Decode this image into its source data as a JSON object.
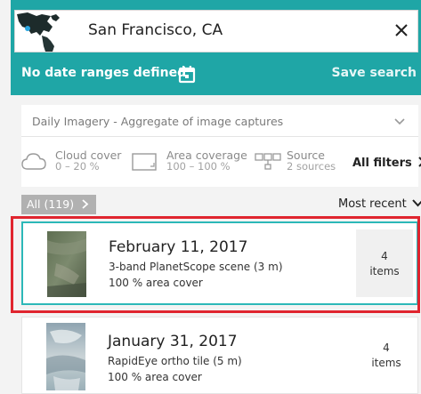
{
  "header": {
    "location": "San Francisco, CA",
    "date_status": "No date ranges defined",
    "save_search": "Save search"
  },
  "filters": {
    "imagery_type": "Daily Imagery - Aggregate of image captures",
    "cloud_cover": {
      "label": "Cloud cover",
      "value": "0 – 20 %"
    },
    "area_coverage": {
      "label": "Area coverage",
      "value": "100 – 100 %"
    },
    "source": {
      "label": "Source",
      "value": "2 sources"
    },
    "all_filters": "All filters"
  },
  "results_header": {
    "all_label": "All (119)",
    "sort": "Most recent"
  },
  "results": [
    {
      "date": "February 11, 2017",
      "description": "3-band PlanetScope scene (3 m)",
      "coverage": "100 % area cover",
      "items_count": "4",
      "items_label": "items"
    },
    {
      "date": "January 31, 2017",
      "description": "RapidEye ortho tile (5 m)",
      "coverage": "100 % area cover",
      "items_count": "4",
      "items_label": "items"
    }
  ],
  "colors": {
    "header_teal": "#1fa6a6",
    "selected_border": "#2cb8b8",
    "highlight_red": "#e0252f",
    "badge_gray": "#b1b1b1"
  },
  "icons": [
    "close-icon",
    "calendar-icon",
    "chevron-down-icon",
    "cloud-icon",
    "area-icon",
    "source-icon",
    "chevron-right-icon"
  ]
}
